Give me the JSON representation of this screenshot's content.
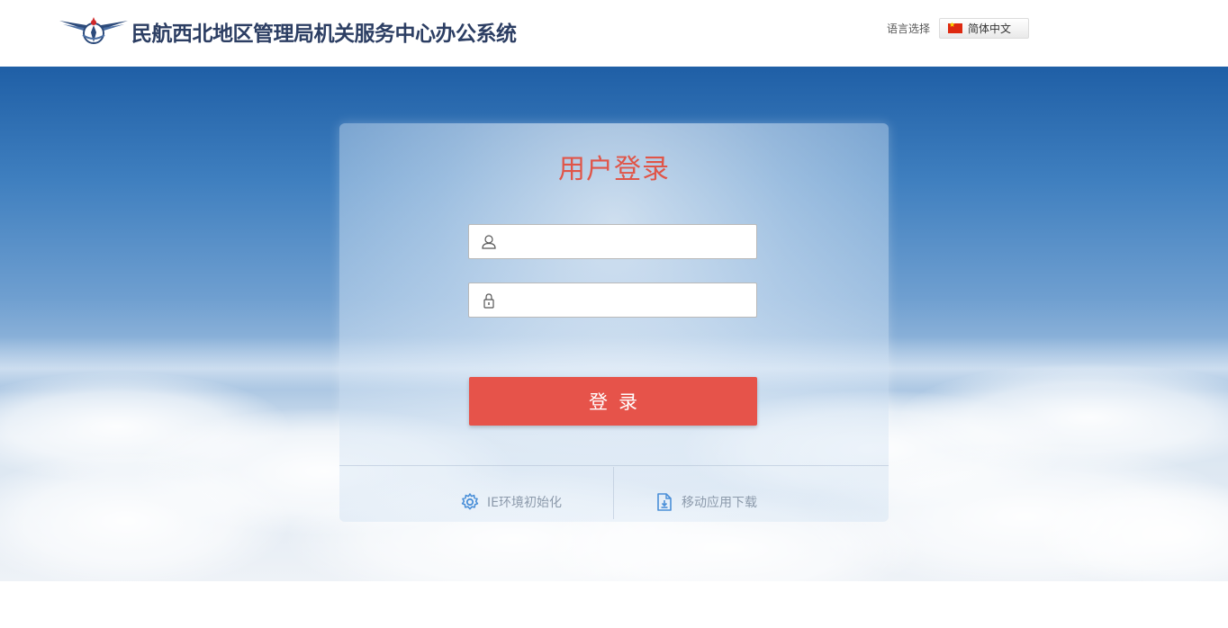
{
  "header": {
    "site_title": "民航西北地区管理局机关服务中心办公系统",
    "language_label": "语言选择",
    "language_value": "简体中文"
  },
  "login": {
    "title": "用户登录",
    "username": {
      "value": "",
      "icon": "user-icon"
    },
    "password": {
      "value": "",
      "icon": "lock-icon"
    },
    "submit_label": "登录"
  },
  "footer_links": {
    "ie_init": {
      "label": "IE环境初始化",
      "icon": "gear-icon"
    },
    "mobile_download": {
      "label": "移动应用下载",
      "icon": "download-doc-icon"
    }
  },
  "colors": {
    "accent": "#e6534a",
    "title": "#e05548",
    "header_text": "#2c3e63",
    "link_icon": "#4a8fd8"
  }
}
